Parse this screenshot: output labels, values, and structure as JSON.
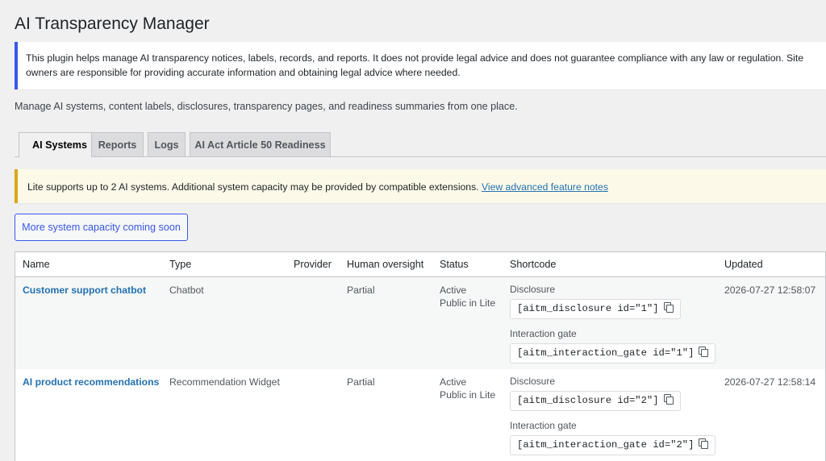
{
  "page": {
    "title": "AI Transparency Manager",
    "info_notice": "This plugin helps manage AI transparency notices, labels, records, and reports. It does not provide legal advice and does not guarantee compliance with any law or regulation. Site owners are responsible for providing accurate information and obtaining legal advice where needed.",
    "intro": "Manage AI systems, content labels, disclosures, transparency pages, and readiness summaries from one place."
  },
  "tabs": [
    {
      "label": "AI Systems",
      "active": true
    },
    {
      "label": "Reports",
      "active": false
    },
    {
      "label": "Logs",
      "active": false
    },
    {
      "label": "AI Act Article 50 Readiness",
      "active": false
    }
  ],
  "capacity_notice": {
    "text": "Lite supports up to 2 AI systems. Additional system capacity may be provided by compatible extensions.",
    "link": "View advanced feature notes"
  },
  "capacity_button": "More system capacity coming soon",
  "table": {
    "headers": [
      "Name",
      "Type",
      "Provider",
      "Human oversight",
      "Status",
      "Shortcode",
      "Updated"
    ],
    "rows": [
      {
        "name": "Customer support chatbot",
        "type": "Chatbot",
        "provider": "",
        "oversight": "Partial",
        "status_1": "Active",
        "status_2": "Public in Lite",
        "disclosure_label": "Disclosure",
        "disclosure_code": "[aitm_disclosure id=\"1\"]",
        "gate_label": "Interaction gate",
        "gate_code": "[aitm_interaction_gate id=\"1\"]",
        "updated": "2026-07-27 12:58:07"
      },
      {
        "name": "AI product recommendations",
        "type": "Recommendation Widget",
        "provider": "",
        "oversight": "Partial",
        "status_1": "Active",
        "status_2": "Public in Lite",
        "disclosure_label": "Disclosure",
        "disclosure_code": "[aitm_disclosure id=\"2\"]",
        "gate_label": "Interaction gate",
        "gate_code": "[aitm_interaction_gate id=\"2\"]",
        "updated": "2026-07-27 12:58:14"
      }
    ]
  },
  "icons": {
    "copy": "copy-icon"
  }
}
